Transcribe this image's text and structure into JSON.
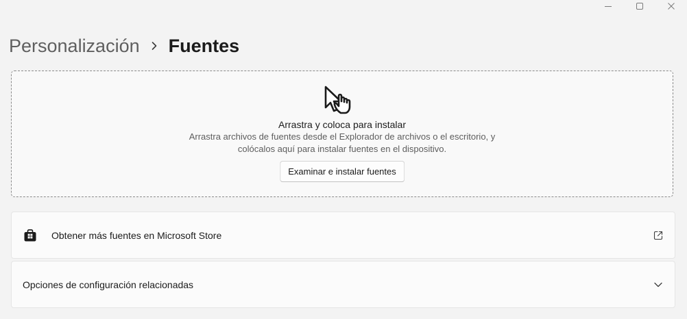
{
  "window": {
    "controls": {
      "minimize_icon": "minimize-icon",
      "maximize_icon": "maximize-icon",
      "close_icon": "close-icon"
    }
  },
  "breadcrumb": {
    "parent": "Personalización",
    "separator_icon": "chevron-right-icon",
    "current": "Fuentes"
  },
  "dropzone": {
    "icon": "drag-hand-cursor-icon",
    "title": "Arrastra y coloca para instalar",
    "description_line1": "Arrastra archivos de fuentes desde el Explorador de archivos o el escritorio, y",
    "description_line2": "colócalos aquí para instalar fuentes en el dispositivo.",
    "button_label": "Examinar e instalar fuentes"
  },
  "store_card": {
    "icon": "microsoft-store-icon",
    "label": "Obtener más fuentes en Microsoft Store",
    "trailing_icon": "external-link-icon"
  },
  "related_card": {
    "label": "Opciones de configuración relacionadas",
    "trailing_icon": "chevron-down-icon"
  },
  "colors": {
    "background": "#f3f3f3",
    "card_background": "#fbfbfb",
    "text_primary": "#1b1b1b",
    "text_secondary": "#5d5d5d"
  }
}
